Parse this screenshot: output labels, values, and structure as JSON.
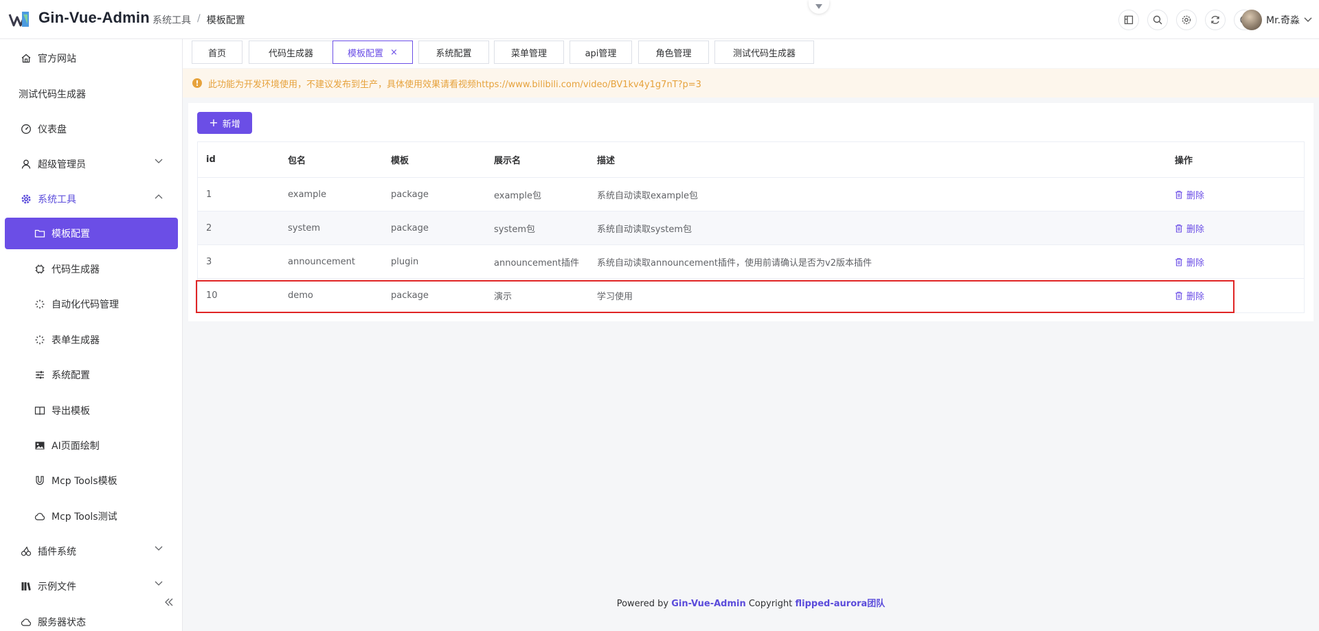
{
  "header": {
    "app_title": "Gin-Vue-Admin",
    "breadcrumb": [
      "系统工具",
      "模板配置"
    ],
    "breadcrumb_sep": "/",
    "icons": [
      "layout-icon",
      "search-icon",
      "settings-icon",
      "refresh-icon",
      "moon-icon"
    ],
    "username": "Mr.奇淼"
  },
  "sidebar": {
    "items": [
      {
        "label": "官方网站",
        "icon": "home-icon"
      },
      {
        "label": "测试代码生成器",
        "icon": ""
      },
      {
        "label": "仪表盘",
        "icon": "dashboard-icon"
      },
      {
        "label": "超级管理员",
        "icon": "user-icon"
      },
      {
        "label": "系统工具",
        "icon": "gear-icon"
      },
      {
        "label": "模板配置",
        "icon": "folder-icon"
      },
      {
        "label": "代码生成器",
        "icon": "cpu-icon"
      },
      {
        "label": "自动化代码管理",
        "icon": "magic-icon"
      },
      {
        "label": "表单生成器",
        "icon": "magic-icon"
      },
      {
        "label": "系统配置",
        "icon": "sliders-icon"
      },
      {
        "label": "导出模板",
        "icon": "book-icon"
      },
      {
        "label": "AI页面绘制",
        "icon": "image-icon"
      },
      {
        "label": "Mcp Tools模板",
        "icon": "magnet-icon"
      },
      {
        "label": "Mcp Tools测试",
        "icon": "cloud-icon"
      },
      {
        "label": "插件系统",
        "icon": "cherry-icon"
      },
      {
        "label": "示例文件",
        "icon": "books-icon"
      },
      {
        "label": "服务器状态",
        "icon": "cloud-icon"
      }
    ]
  },
  "tabs": [
    {
      "label": "首页"
    },
    {
      "label": "代码生成器"
    },
    {
      "label": "模板配置",
      "close": "×"
    },
    {
      "label": "系统配置"
    },
    {
      "label": "菜单管理"
    },
    {
      "label": "api管理"
    },
    {
      "label": "角色管理"
    },
    {
      "label": "测试代码生成器"
    }
  ],
  "alert": {
    "text": "此功能为开发环境使用，不建议发布到生产，具体使用效果请看视频https://www.bilibili.com/video/BV1kv4y1g7nT?p=3",
    "icon": "!"
  },
  "toolbar": {
    "add_label": "新增",
    "add_icon": "+"
  },
  "table": {
    "columns": [
      "id",
      "包名",
      "模板",
      "展示名",
      "描述",
      "操作"
    ],
    "rows": [
      {
        "id": "1",
        "package": "example",
        "template": "package",
        "label": "example包",
        "desc": "系统自动读取example包",
        "action": "删除"
      },
      {
        "id": "2",
        "package": "system",
        "template": "package",
        "label": "system包",
        "desc": "系统自动读取system包",
        "action": "删除"
      },
      {
        "id": "3",
        "package": "announcement",
        "template": "plugin",
        "label": "announcement插件",
        "desc": "系统自动读取announcement插件，使用前请确认是否为v2版本插件",
        "action": "删除"
      },
      {
        "id": "10",
        "package": "demo",
        "template": "package",
        "label": "演示",
        "desc": "学习使用",
        "action": "删除"
      }
    ]
  },
  "footer": {
    "powered": "Powered by",
    "brand": "Gin-Vue-Admin",
    "copyright": "Copyright",
    "team": "flipped-aurora团队"
  },
  "colors": {
    "accent": "#6b4ee6",
    "warning": "#e6a23c",
    "highlight": "#e02424"
  }
}
